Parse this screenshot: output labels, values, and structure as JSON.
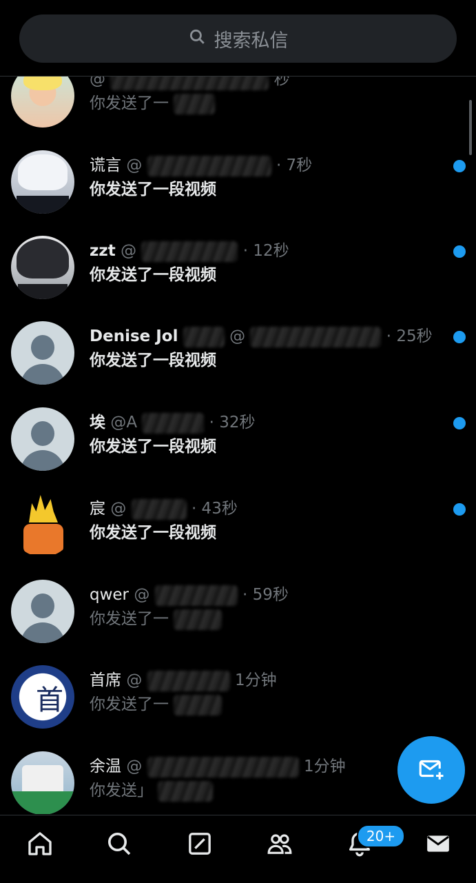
{
  "search": {
    "placeholder": "搜索私信"
  },
  "conversations": [
    {
      "name": "",
      "handle": "@",
      "time": "秒",
      "preview": "你发送了一",
      "unread": false
    },
    {
      "name": "谎言",
      "handle": "@",
      "time": "· 7秒",
      "preview": "你发送了一段视频",
      "unread": true
    },
    {
      "name": "zzt",
      "handle": "@",
      "time": "· 12秒",
      "preview": "你发送了一段视频",
      "unread": true
    },
    {
      "name": "Denise Jol",
      "handle": "@",
      "time": "· 25秒",
      "preview": "你发送了一段视频",
      "unread": true
    },
    {
      "name": "埃",
      "handle": "@A",
      "time": "· 32秒",
      "preview": "你发送了一段视频",
      "unread": true
    },
    {
      "name": "宸",
      "handle": "@",
      "time": "· 43秒",
      "preview": "你发送了一段视频",
      "unread": true
    },
    {
      "name": "qwer",
      "handle": "@",
      "time": "· 59秒",
      "preview": "你发送了一",
      "unread": false
    },
    {
      "name": "首席",
      "handle": "@",
      "time": "1分钟",
      "preview": "你发送了一",
      "unread": false
    },
    {
      "name": "余温",
      "handle": "@",
      "time": "1分钟",
      "preview": "你发送」",
      "unread": false
    }
  ],
  "avatar_art": {
    "chief_glyph": "首"
  },
  "tabbar": {
    "items": [
      "home-icon",
      "search-icon",
      "compose-icon",
      "communities-icon",
      "notifications-icon",
      "messages-icon"
    ],
    "notification_badge": "20+"
  },
  "fab": {
    "icon": "new-message-icon"
  },
  "colors": {
    "accent": "#1d9bf0",
    "background": "#000000",
    "muted": "#71767b"
  }
}
